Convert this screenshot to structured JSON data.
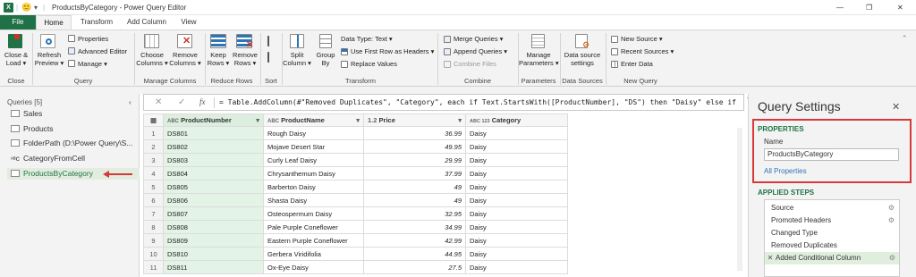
{
  "title": {
    "app_icon": "X",
    "smiley": "🙂",
    "dropdown_arrow": "▾",
    "separator": "|",
    "text": "ProductsByCategory - Power Query Editor",
    "controls": {
      "minimize": "—",
      "restore": "❐",
      "close": "✕"
    }
  },
  "tabs": [
    "File",
    "Home",
    "Transform",
    "Add Column",
    "View"
  ],
  "ribbon": {
    "close_load": [
      "Close &",
      "Load ▾"
    ],
    "refresh_preview": [
      "Refresh",
      "Preview ▾"
    ],
    "properties": "Properties",
    "advanced_editor": "Advanced Editor",
    "manage": "Manage ▾",
    "choose_columns": [
      "Choose",
      "Columns ▾"
    ],
    "remove_columns": [
      "Remove",
      "Columns ▾"
    ],
    "keep_rows": [
      "Keep",
      "Rows ▾"
    ],
    "remove_rows": [
      "Remove",
      "Rows ▾"
    ],
    "split_column": [
      "Split",
      "Column ▾"
    ],
    "group_by": [
      "Group",
      "By"
    ],
    "data_type": "Data Type: Text ▾",
    "use_first_row": "Use First Row as Headers ▾",
    "replace_values": "Replace Values",
    "merge_queries": "Merge Queries ▾",
    "append_queries": "Append Queries ▾",
    "combine_files": "Combine Files",
    "manage_parameters": [
      "Manage",
      "Parameters ▾"
    ],
    "data_source_settings": [
      "Data source",
      "settings"
    ],
    "new_source": "New Source ▾",
    "recent_sources": "Recent Sources ▾",
    "enter_data": "Enter Data",
    "collapse_arrow": "⌃",
    "groups": [
      "Close",
      "Query",
      "Manage Columns",
      "Reduce Rows",
      "Sort",
      "Transform",
      "Combine",
      "Parameters",
      "Data Sources",
      "New Query"
    ]
  },
  "queries": {
    "header": "Queries [5]",
    "collapse_arrow": "‹",
    "items": [
      {
        "label": "Sales",
        "icon": "table-icon"
      },
      {
        "label": "Products",
        "icon": "table-icon"
      },
      {
        "label": "FolderPath (D:\\Power Query\\S...",
        "icon": "table-icon"
      },
      {
        "label": "CategoryFromCell",
        "icon": "abc-icon",
        "icon_text": "ᴬᴮC"
      },
      {
        "label": "ProductsByCategory",
        "icon": "table-icon",
        "selected": true
      }
    ]
  },
  "formula": {
    "cancel": "✕",
    "confirm": "✓",
    "fx": "fx",
    "text": "= Table.AddColumn(#\"Removed Duplicates\", \"Category\", each if Text.StartsWith([ProductNumber], \"DS\") then \"Daisy\" else if"
  },
  "grid": {
    "columns": [
      {
        "name": "ProductNumber",
        "type": "ABC"
      },
      {
        "name": "ProductName",
        "type": "ABC"
      },
      {
        "name": "Price",
        "type": "1.2"
      },
      {
        "name": "Category",
        "type": "ABC 123"
      }
    ],
    "rows": [
      [
        "1",
        "DS801",
        "Rough Daisy",
        "36.99",
        "Daisy"
      ],
      [
        "2",
        "DS802",
        "Mojave Desert Star",
        "49.95",
        "Daisy"
      ],
      [
        "3",
        "DS803",
        "Curly Leaf Daisy",
        "29.99",
        "Daisy"
      ],
      [
        "4",
        "DS804",
        "Chrysanthemum Daisy",
        "37.99",
        "Daisy"
      ],
      [
        "5",
        "DS805",
        "Barberton Daisy",
        "49",
        "Daisy"
      ],
      [
        "6",
        "DS806",
        "Shasta Daisy",
        "49",
        "Daisy"
      ],
      [
        "7",
        "DS807",
        "Osteospermum Daisy",
        "32.95",
        "Daisy"
      ],
      [
        "8",
        "DS808",
        "Pale Purple Coneflower",
        "34.99",
        "Daisy"
      ],
      [
        "9",
        "DS809",
        "Eastern Purple Coneflower",
        "42.99",
        "Daisy"
      ],
      [
        "10",
        "DS810",
        "Gerbera Viridifolia",
        "44.95",
        "Daisy"
      ],
      [
        "11",
        "DS811",
        "Ox-Eye Daisy",
        "27.5",
        "Daisy"
      ]
    ]
  },
  "settings": {
    "title": "Query Settings",
    "close": "✕",
    "properties_header": "PROPERTIES",
    "name_label": "Name",
    "name_value": "ProductsByCategory",
    "all_properties": "All Properties",
    "steps_header": "APPLIED STEPS",
    "steps": [
      {
        "label": "Source",
        "gear": true
      },
      {
        "label": "Promoted Headers",
        "gear": true
      },
      {
        "label": "Changed Type",
        "gear": false
      },
      {
        "label": "Removed Duplicates",
        "gear": false
      },
      {
        "label": "Added Conditional Column",
        "gear": true,
        "selected": true
      }
    ],
    "step_delete_icon": "✕",
    "gear_icon": "⚙"
  },
  "colors": {
    "accent_green": "#217346",
    "file_tab": "#1f7246",
    "highlight_red": "#d9383a",
    "selected_col": "#e3f3e6"
  }
}
